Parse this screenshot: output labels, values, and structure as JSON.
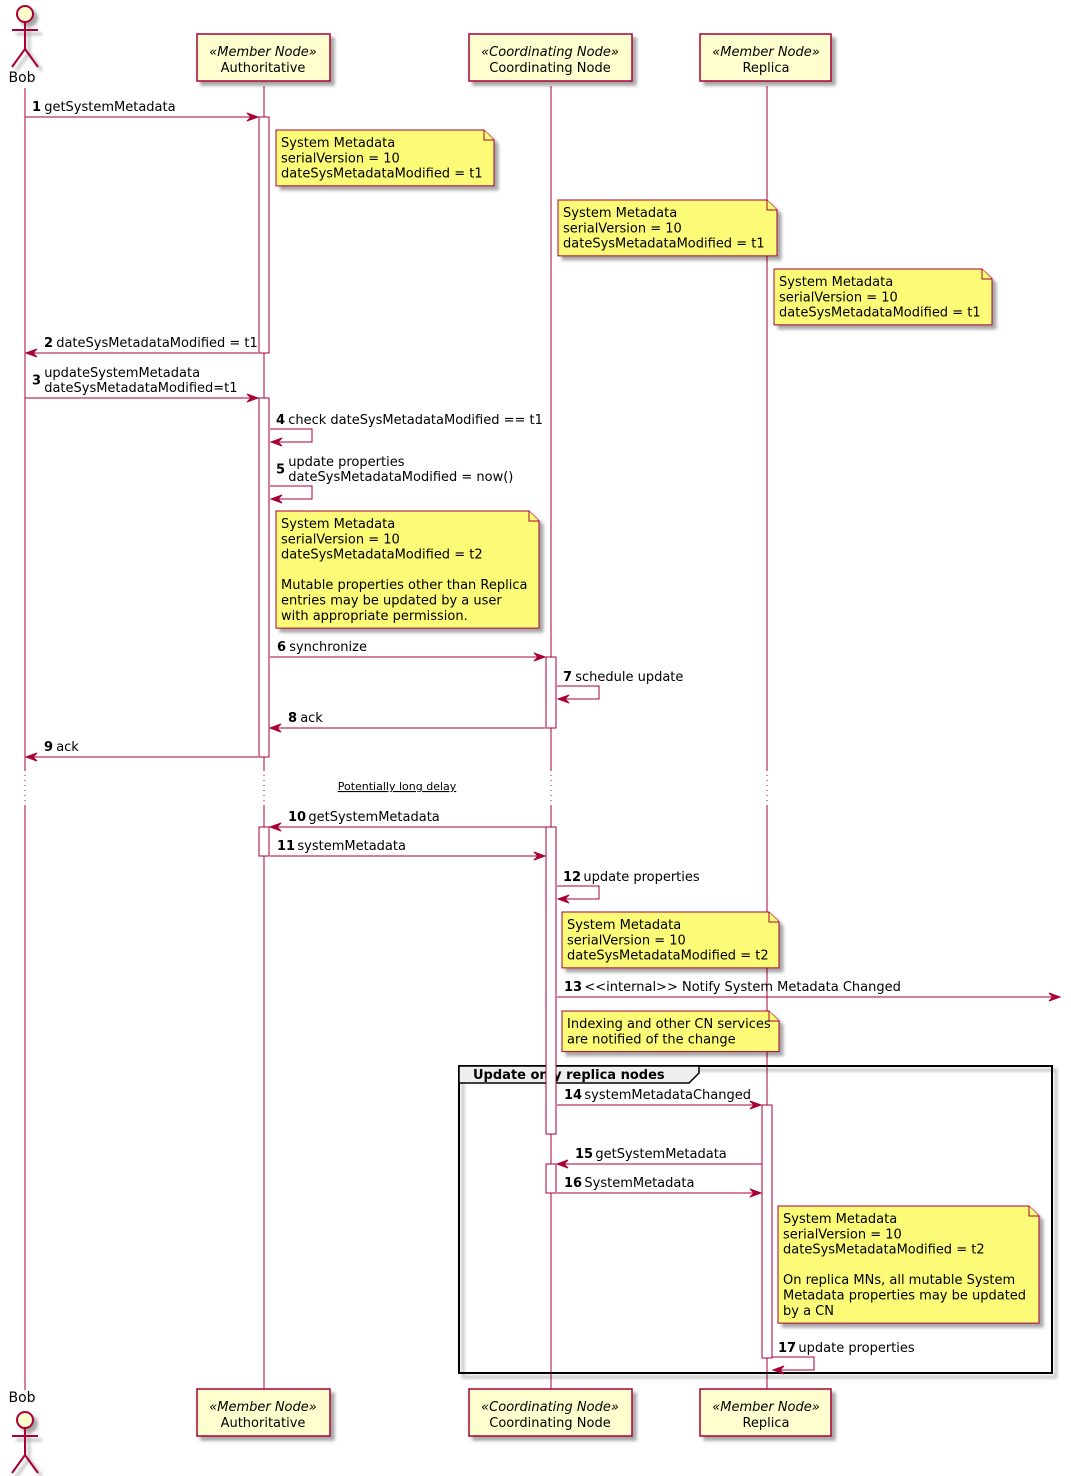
{
  "diagram": {
    "type": "sequence",
    "participants": [
      {
        "id": "bob",
        "kind": "actor",
        "name": "Bob",
        "stereotype": ""
      },
      {
        "id": "auth",
        "kind": "participant",
        "name": "Authoritative",
        "stereotype": "«Member Node»"
      },
      {
        "id": "cn",
        "kind": "participant",
        "name": "Coordinating Node",
        "stereotype": "«Coordinating Node»"
      },
      {
        "id": "replica",
        "kind": "participant",
        "name": "Replica",
        "stereotype": "«Member Node»"
      }
    ],
    "messages": [
      {
        "num": "1",
        "from": "bob",
        "to": "auth",
        "lines": [
          "getSystemMetadata"
        ]
      },
      {
        "num": "2",
        "from": "auth",
        "to": "bob",
        "lines": [
          "dateSysMetadataModified = t1"
        ]
      },
      {
        "num": "3",
        "from": "bob",
        "to": "auth",
        "lines": [
          "updateSystemMetadata",
          "dateSysMetadataModified=t1"
        ]
      },
      {
        "num": "4",
        "from": "auth",
        "to": "auth",
        "lines": [
          "check dateSysMetadataModified == t1"
        ]
      },
      {
        "num": "5",
        "from": "auth",
        "to": "auth",
        "lines": [
          "update properties",
          "dateSysMetadataModified = now()"
        ]
      },
      {
        "num": "6",
        "from": "auth",
        "to": "cn",
        "lines": [
          "synchronize"
        ]
      },
      {
        "num": "7",
        "from": "cn",
        "to": "cn",
        "lines": [
          "schedule update"
        ]
      },
      {
        "num": "8",
        "from": "cn",
        "to": "auth",
        "lines": [
          "ack"
        ]
      },
      {
        "num": "9",
        "from": "auth",
        "to": "bob",
        "lines": [
          "ack"
        ]
      },
      {
        "num": "10",
        "from": "cn",
        "to": "auth",
        "lines": [
          "getSystemMetadata"
        ]
      },
      {
        "num": "11",
        "from": "auth",
        "to": "cn",
        "lines": [
          "systemMetadata"
        ]
      },
      {
        "num": "12",
        "from": "cn",
        "to": "cn",
        "lines": [
          "update properties"
        ]
      },
      {
        "num": "13",
        "from": "cn",
        "to": "external",
        "lines": [
          "<<internal>> Notify System Metadata Changed"
        ]
      },
      {
        "num": "14",
        "from": "cn",
        "to": "replica",
        "lines": [
          "systemMetadataChanged"
        ]
      },
      {
        "num": "15",
        "from": "replica",
        "to": "cn",
        "lines": [
          "getSystemMetadata"
        ]
      },
      {
        "num": "16",
        "from": "cn",
        "to": "replica",
        "lines": [
          "SystemMetadata"
        ]
      },
      {
        "num": "17",
        "from": "replica",
        "to": "replica",
        "lines": [
          "update properties"
        ]
      }
    ],
    "notes": [
      {
        "over": "auth",
        "lines": [
          "System Metadata",
          "serialVersion = 10",
          "dateSysMetadataModified = t1"
        ]
      },
      {
        "over": "cn",
        "lines": [
          "System Metadata",
          "serialVersion = 10",
          "dateSysMetadataModified = t1"
        ]
      },
      {
        "over": "replica",
        "lines": [
          "System Metadata",
          "serialVersion = 10",
          "dateSysMetadataModified = t1"
        ]
      },
      {
        "over": "auth",
        "lines": [
          "System Metadata",
          "serialVersion = 10",
          "dateSysMetadataModified = t2",
          "",
          "Mutable properties other than Replica",
          "entries may be updated by a user",
          "with appropriate permission."
        ]
      },
      {
        "over": "cn",
        "lines": [
          "System Metadata",
          "serialVersion = 10",
          "dateSysMetadataModified = t2"
        ]
      },
      {
        "over": "cn",
        "lines": [
          "Indexing and other CN services",
          "are notified of the change"
        ]
      },
      {
        "over": "replica",
        "lines": [
          "System Metadata",
          "serialVersion = 10",
          "dateSysMetadataModified = t2",
          "",
          "On replica MNs, all mutable System",
          "Metadata properties may be updated",
          "by a CN"
        ]
      }
    ],
    "delay_label": "Potentially long delay",
    "group": {
      "title": "Update only replica nodes"
    },
    "colors": {
      "line": "#a80036",
      "participant_fill": "#fefece",
      "note_fill": "#fbfb77",
      "group_label_fill": "#eeeeee"
    }
  }
}
